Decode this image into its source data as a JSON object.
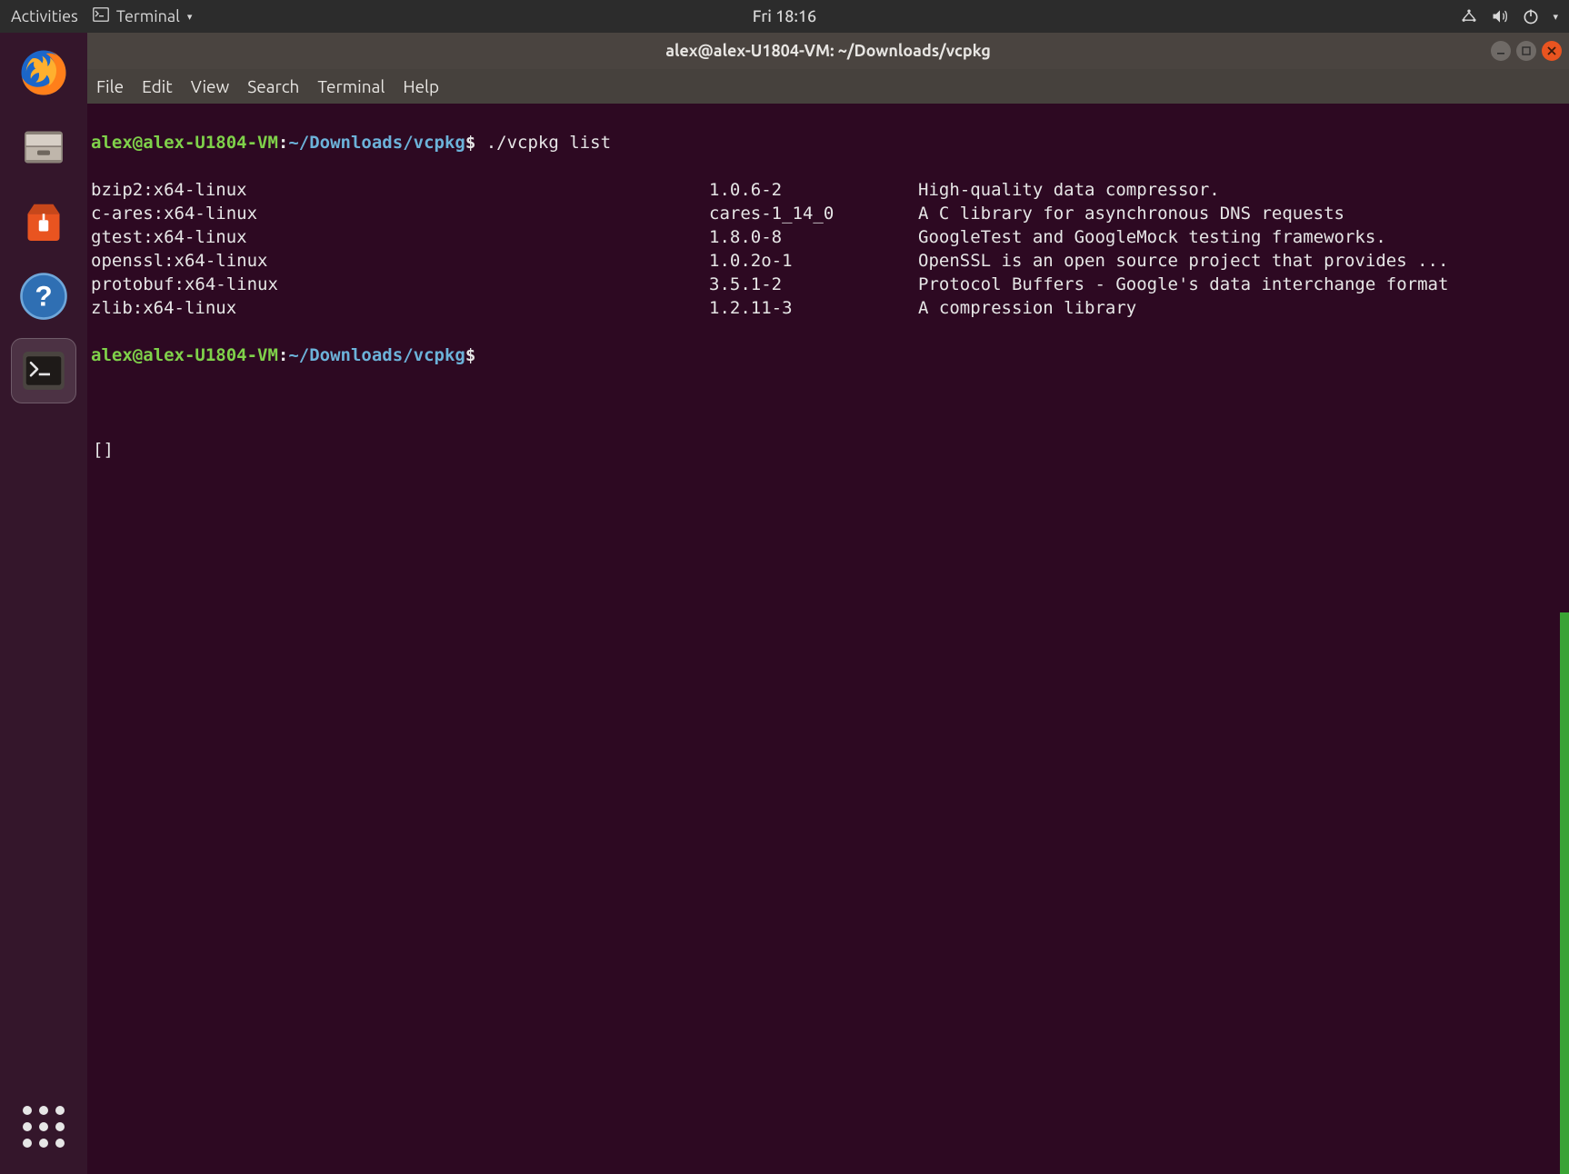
{
  "top_panel": {
    "activities": "Activities",
    "app_name": "Terminal",
    "clock": "Fri 18:16"
  },
  "dock": {
    "items": [
      {
        "name": "firefox"
      },
      {
        "name": "files"
      },
      {
        "name": "software"
      },
      {
        "name": "help"
      },
      {
        "name": "terminal",
        "active": true
      }
    ]
  },
  "window": {
    "title": "alex@alex-U1804-VM: ~/Downloads/vcpkg",
    "menus": [
      "File",
      "Edit",
      "View",
      "Search",
      "Terminal",
      "Help"
    ]
  },
  "prompt": {
    "user_host": "alex@alex-U1804-VM",
    "sep": ":",
    "path": "~/Downloads/vcpkg",
    "sigil": "$"
  },
  "command": "./vcpkg list",
  "packages": [
    {
      "name": "bzip2:x64-linux",
      "version": "1.0.6-2",
      "desc": "High-quality data compressor."
    },
    {
      "name": "c-ares:x64-linux",
      "version": "cares-1_14_0",
      "desc": "A C library for asynchronous DNS requests"
    },
    {
      "name": "gtest:x64-linux",
      "version": "1.8.0-8",
      "desc": "GoogleTest and GoogleMock testing frameworks."
    },
    {
      "name": "openssl:x64-linux",
      "version": "1.0.2o-1",
      "desc": "OpenSSL is an open source project that provides ..."
    },
    {
      "name": "protobuf:x64-linux",
      "version": "3.5.1-2",
      "desc": "Protocol Buffers - Google's data interchange format"
    },
    {
      "name": "zlib:x64-linux",
      "version": "1.2.11-3",
      "desc": "A compression library"
    }
  ],
  "cursor_glyph": "[]"
}
